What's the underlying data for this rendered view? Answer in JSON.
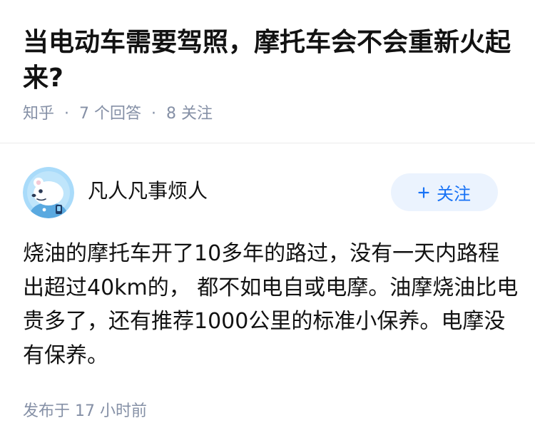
{
  "question": {
    "title": "当电动车需要驾照，摩托车会不会重新火起来?",
    "meta": {
      "source": "知乎",
      "separator": "·",
      "answer_count": "7 个回答",
      "follower_count": "8 关注"
    }
  },
  "answer": {
    "author": {
      "name": "凡人凡事烦人",
      "avatar_icon": "bear-avatar-icon"
    },
    "follow_button": {
      "icon": "plus-icon",
      "label": "关注"
    },
    "content_lines": [
      "烧油的摩托车开了10多年的路过，没有一天内路程",
      "出超过40km的， 都不如电自或电摩。油摩烧油比电",
      "贵多了，还有推荐1000公里的标准小保养。电摩没",
      "有保养。"
    ],
    "published_time": "发布于 17 小时前"
  },
  "colors": {
    "text_primary": "#121212",
    "text_secondary": "#8590a6",
    "accent": "#1772f6",
    "follow_button_bg": "#ebf3fe",
    "divider": "#ebebeb",
    "avatar_bg": "#a9dbfa"
  }
}
